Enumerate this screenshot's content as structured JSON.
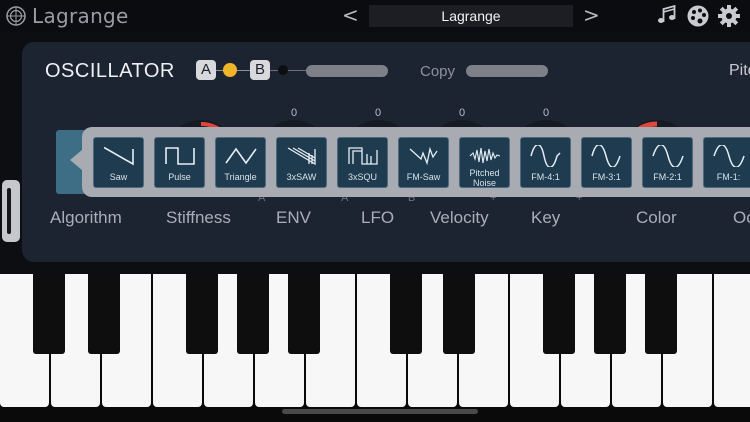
{
  "header": {
    "app_title": "Lagrange",
    "preset_name": "Lagrange",
    "prev_label": "<",
    "next_label": ">",
    "icons": [
      "logo-icon",
      "music-notes-icon",
      "palette-icon",
      "gear-icon"
    ]
  },
  "oscillator": {
    "title": "OSCILLATOR",
    "chip_a": "A",
    "chip_b": "B",
    "copy_label": "Copy",
    "pitch_label": "Pitc"
  },
  "values": [
    "0",
    "0",
    "0",
    "0"
  ],
  "params": {
    "algorithm": "Algorithm",
    "stiffness": "Stiffness",
    "env": "ENV",
    "lfo": "LFO",
    "velocity": "Velocity",
    "key": "Key",
    "color": "Color",
    "oct": "Oc"
  },
  "marks": {
    "env_a": "A",
    "lfo_a": "A",
    "velocity_b": "B",
    "plus": "+",
    "minus": "−"
  },
  "waveforms": [
    {
      "label": "Saw",
      "icon": "saw-wave-icon"
    },
    {
      "label": "Pulse",
      "icon": "pulse-wave-icon"
    },
    {
      "label": "Triangle",
      "icon": "triangle-wave-icon"
    },
    {
      "label": "3xSAW",
      "icon": "triple-saw-icon"
    },
    {
      "label": "3xSQU",
      "icon": "triple-square-icon"
    },
    {
      "label": "FM-Saw",
      "icon": "fm-saw-icon"
    },
    {
      "label": "Pitched Noise",
      "icon": "pitched-noise-icon"
    },
    {
      "label": "FM-4:1",
      "icon": "fm-sine-icon"
    },
    {
      "label": "FM-3:1",
      "icon": "fm-sine-icon"
    },
    {
      "label": "FM-2:1",
      "icon": "fm-sine-icon"
    },
    {
      "label": "FM-1:",
      "icon": "fm-sine-icon"
    }
  ],
  "colors": {
    "accent_yellow": "#f0b429",
    "knob_red": "#e0463c",
    "indicator_blue": "#5fb3ff",
    "selected_teal": "#3d6e86"
  }
}
